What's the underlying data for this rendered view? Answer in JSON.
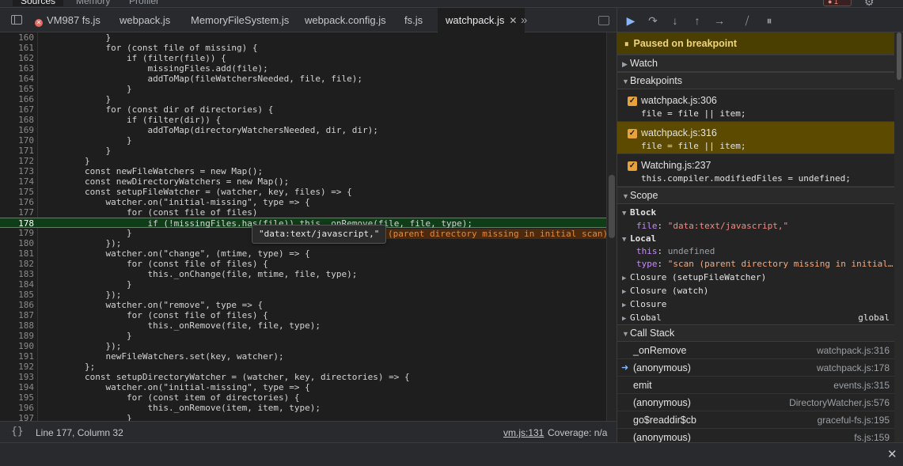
{
  "panel_tabs": [
    "Sources",
    "Memory",
    "Profiler"
  ],
  "error_badge": "1",
  "file_tabs": [
    {
      "label": "VM987 fs.js",
      "has_error": true
    },
    {
      "label": "webpack.js"
    },
    {
      "label": "MemoryFileSystem.js"
    },
    {
      "label": "webpack.config.js"
    },
    {
      "label": "fs.js"
    },
    {
      "label": "watchpack.js",
      "active": true
    }
  ],
  "editor": {
    "lines": [
      {
        "n": "160",
        "code": "            }"
      },
      {
        "n": "161",
        "code": "            for (const file of missing) {"
      },
      {
        "n": "162",
        "code": "                if (filter(file)) {"
      },
      {
        "n": "163",
        "code": "                    missingFiles.add(file);"
      },
      {
        "n": "164",
        "code": "                    addToMap(fileWatchersNeeded, file, file);"
      },
      {
        "n": "165",
        "code": "                }"
      },
      {
        "n": "166",
        "code": "            }"
      },
      {
        "n": "167",
        "code": "            for (const dir of directories) {"
      },
      {
        "n": "168",
        "code": "                if (filter(dir)) {"
      },
      {
        "n": "169",
        "code": "                    addToMap(directoryWatchersNeeded, dir, dir);"
      },
      {
        "n": "170",
        "code": "                }"
      },
      {
        "n": "171",
        "code": "            }"
      },
      {
        "n": "172",
        "code": "        }"
      },
      {
        "n": "173",
        "code": "        const newFileWatchers = new Map();"
      },
      {
        "n": "174",
        "code": "        const newDirectoryWatchers = new Map();"
      },
      {
        "n": "175",
        "code": "        const setupFileWatcher = (watcher, key, files) => {"
      },
      {
        "n": "176",
        "code": "            watcher.on(\"initial-missing\", type => {"
      },
      {
        "n": "177",
        "code": "                for (const file of files)"
      },
      {
        "n": "178",
        "code": "                    if (!missingFiles.has(file)) this._onRemove(file, file, type);"
      },
      {
        "n": "179",
        "code": "                }"
      },
      {
        "n": "180",
        "code": "            });"
      },
      {
        "n": "181",
        "code": "            watcher.on(\"change\", (mtime, type) => {"
      },
      {
        "n": "182",
        "code": "                for (const file of files) {"
      },
      {
        "n": "183",
        "code": "                    this._onChange(file, mtime, file, type);"
      },
      {
        "n": "184",
        "code": "                }"
      },
      {
        "n": "185",
        "code": "            });"
      },
      {
        "n": "186",
        "code": "            watcher.on(\"remove\", type => {"
      },
      {
        "n": "187",
        "code": "                for (const file of files) {"
      },
      {
        "n": "188",
        "code": "                    this._onRemove(file, file, type);"
      },
      {
        "n": "189",
        "code": "                }"
      },
      {
        "n": "190",
        "code": "            });"
      },
      {
        "n": "191",
        "code": "            newFileWatchers.set(key, watcher);"
      },
      {
        "n": "192",
        "code": "        };"
      },
      {
        "n": "193",
        "code": "        const setupDirectoryWatcher = (watcher, key, directories) => {"
      },
      {
        "n": "194",
        "code": "            watcher.on(\"initial-missing\", type => {"
      },
      {
        "n": "195",
        "code": "                for (const item of directories) {"
      },
      {
        "n": "196",
        "code": "                    this._onRemove(item, item, type);"
      },
      {
        "n": "197",
        "code": "                }"
      }
    ],
    "exec_line": "178",
    "tooltip": "\"data:text/javascript,\"",
    "inline_value": "(parent directory missing in initial scan)"
  },
  "status": {
    "braces": "{}",
    "cursor": "Line 177, Column 32",
    "source_link": "vm.js:131",
    "coverage": "Coverage: n/a"
  },
  "sidebar": {
    "paused": "Paused on breakpoint",
    "sections": {
      "watch": "Watch",
      "breakpoints": "Breakpoints",
      "scope": "Scope",
      "callstack": "Call Stack"
    },
    "breakpoints": [
      {
        "name": "watchpack.js:306",
        "code": "file = file || item;",
        "active": false
      },
      {
        "name": "watchpack.js:316",
        "code": "file = file || item;",
        "active": true
      },
      {
        "name": "Watching.js:237",
        "code": "this.compiler.modifiedFiles = undefined;",
        "active": false
      }
    ],
    "scope": {
      "block_label": "Block",
      "block_file_key": "file",
      "block_file_val": "\"data:text/javascript,\"",
      "local_label": "Local",
      "local_this_key": "this",
      "local_this_val": "undefined",
      "local_type_key": "type",
      "local_type_val": "\"scan (parent directory missing in initial…",
      "closures": [
        "Closure (setupFileWatcher)",
        "Closure (watch)",
        "Closure"
      ],
      "global_label": "Global",
      "global_val": "global"
    },
    "callstack": [
      {
        "fn": "_onRemove",
        "loc": "watchpack.js:316"
      },
      {
        "fn": "(anonymous)",
        "loc": "watchpack.js:178",
        "current": true
      },
      {
        "fn": "emit",
        "loc": "events.js:315"
      },
      {
        "fn": "(anonymous)",
        "loc": "DirectoryWatcher.js:576"
      },
      {
        "fn": "go$readdir$cb",
        "loc": "graceful-fs.js:195"
      },
      {
        "fn": "(anonymous)",
        "loc": "fs.js:159"
      }
    ]
  },
  "colors": {
    "exec_line_bg": "#0f3d18",
    "paused_bg": "#4b3f00",
    "breakpoint_check": "#e8a23b"
  }
}
